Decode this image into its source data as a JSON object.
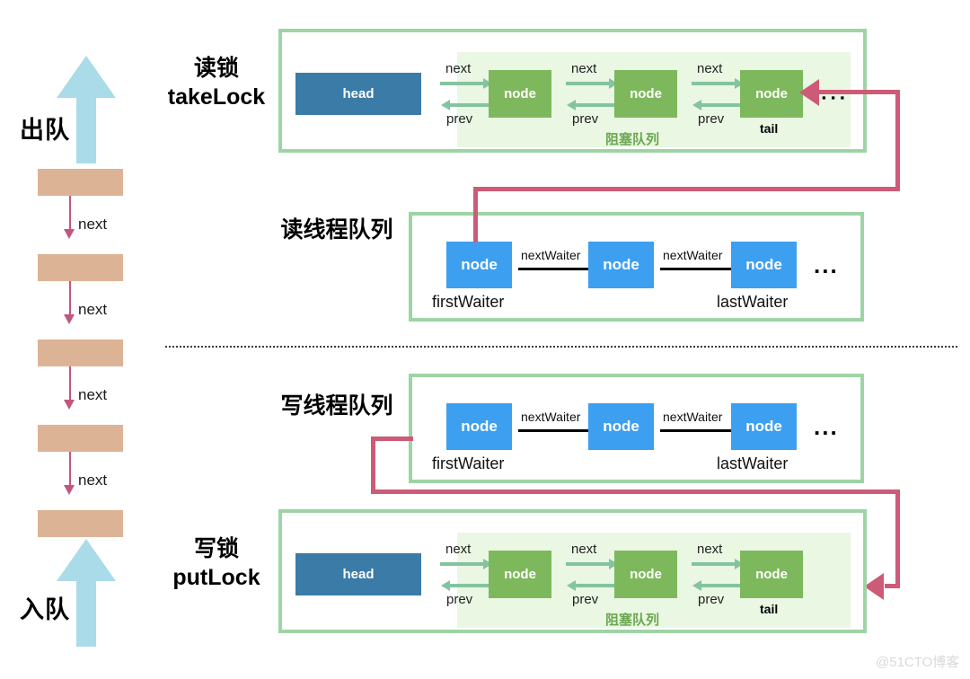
{
  "left_column": {
    "dequeue_label": "出队",
    "enqueue_label": "入队",
    "next_labels": [
      "next",
      "next",
      "next",
      "next"
    ],
    "box_count": 5,
    "arrow_color": "#aadbe8",
    "box_color": "#ddb396",
    "link_color": "#c1567f"
  },
  "sections": {
    "read_lock": {
      "title": "读锁\ntakeLock",
      "head_label": "head",
      "nodes": [
        "node",
        "node",
        "node"
      ],
      "tail_label": "tail",
      "blocking_queue_label": "阻塞队列",
      "next_label": "next",
      "prev_label": "prev",
      "ellipsis": "▪ ▪ ▪"
    },
    "read_waiter_queue": {
      "title": "读线程队列",
      "nodes": [
        "node",
        "node",
        "node"
      ],
      "first_waiter_label": "firstWaiter",
      "last_waiter_label": "lastWaiter",
      "next_waiter_label": "nextWaiter",
      "ellipsis": "..."
    },
    "write_waiter_queue": {
      "title": "写线程队列",
      "nodes": [
        "node",
        "node",
        "node"
      ],
      "first_waiter_label": "firstWaiter",
      "last_waiter_label": "lastWaiter",
      "next_waiter_label": "nextWaiter",
      "ellipsis": "..."
    },
    "write_lock": {
      "title": "写锁\nputLock",
      "head_label": "head",
      "nodes": [
        "node",
        "node",
        "node"
      ],
      "tail_label": "tail",
      "blocking_queue_label": "阻塞队列",
      "next_label": "next",
      "prev_label": "prev"
    }
  },
  "colors": {
    "panel_border": "#9ed4a5",
    "inner_green": "#eaf7e2",
    "head_blue": "#3a7ba8",
    "node_green": "#7eb85c",
    "node_blue": "#3d9ff0",
    "pink_link": "#cd5b77",
    "green_arrow": "#83c4a0"
  },
  "watermark": "@51CTO博客"
}
